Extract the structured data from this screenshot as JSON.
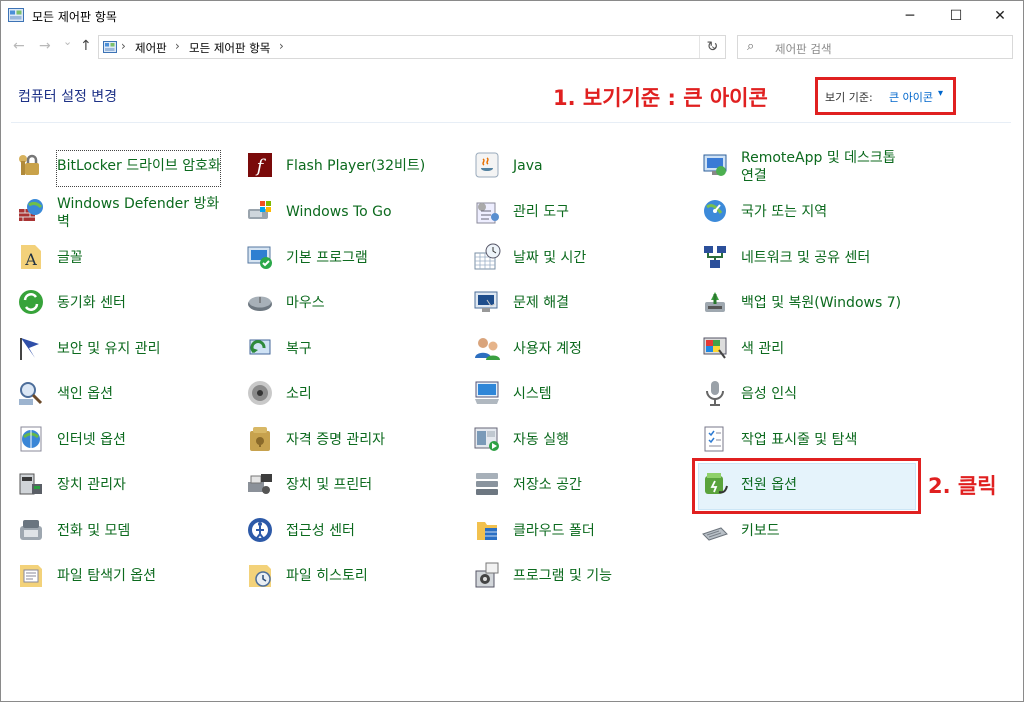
{
  "window": {
    "title": "모든 제어판 항목"
  },
  "titlebar_buttons": {
    "minimize": "─",
    "maximize": "☐",
    "close": "✕"
  },
  "nav": {
    "back": "←",
    "forward": "→",
    "recent": "⌄",
    "up": "↑",
    "refresh": "↻",
    "dropdown": "⌄"
  },
  "address": {
    "sep": "›",
    "crumbs": [
      "제어판",
      "모든 제어판 항목"
    ]
  },
  "search": {
    "icon": "⌕",
    "placeholder": "제어판 검색"
  },
  "header": {
    "title": "컴퓨터 설정 변경",
    "view_label": "보기 기준:",
    "view_value": "큰 아이콘",
    "view_caret": "▾"
  },
  "annotations": {
    "step1": "1. 보기기준 : 큰 아이콘",
    "step2": "2. 클릭",
    "color": "#e02020"
  },
  "items": [
    [
      "BitLocker 드라이브 암호화",
      "Flash Player(32비트)",
      "Java",
      "RemoteApp 및 데스크톱 연결"
    ],
    [
      "Windows Defender 방화벽",
      "Windows To Go",
      "관리 도구",
      "국가 또는 지역"
    ],
    [
      "글꼴",
      "기본 프로그램",
      "날짜 및 시간",
      "네트워크 및 공유 센터"
    ],
    [
      "동기화 센터",
      "마우스",
      "문제 해결",
      "백업 및 복원(Windows 7)"
    ],
    [
      "보안 및 유지 관리",
      "복구",
      "사용자 계정",
      "색 관리"
    ],
    [
      "색인 옵션",
      "소리",
      "시스템",
      "음성 인식"
    ],
    [
      "인터넷 옵션",
      "자격 증명 관리자",
      "자동 실행",
      "작업 표시줄 및 탐색"
    ],
    [
      "장치 관리자",
      "장치 및 프린터",
      "저장소 공간",
      "전원 옵션"
    ],
    [
      "전화 및 모뎀",
      "접근성 센터",
      "클라우드 폴더",
      "키보드"
    ],
    [
      "파일 탐색기 옵션",
      "파일 히스토리",
      "프로그램 및 기능",
      ""
    ]
  ],
  "colors": {
    "link_green": "#0c6a1e",
    "heading_blue": "#1e3287",
    "hover": "#e5f3fb"
  }
}
